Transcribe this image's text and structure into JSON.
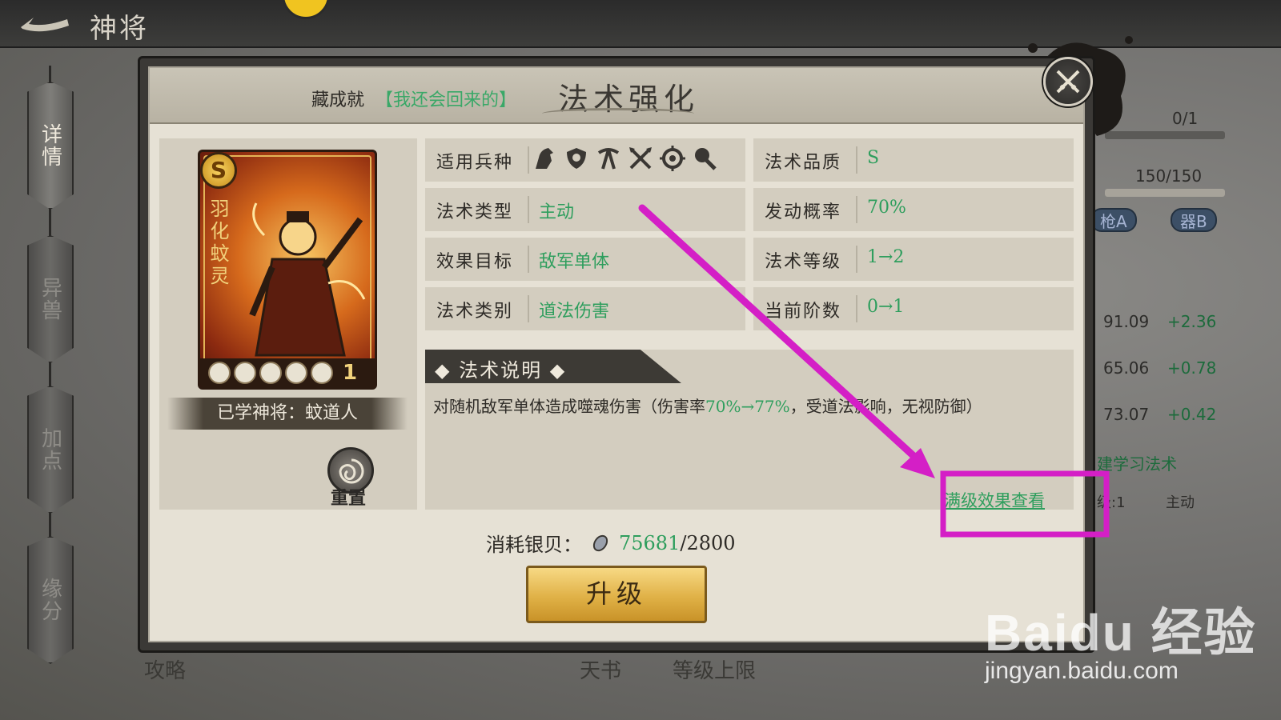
{
  "topbar": {
    "title": "神将"
  },
  "sidenav": [
    {
      "label": "详情",
      "active": true
    },
    {
      "label": "异兽",
      "active": false
    },
    {
      "label": "加点",
      "active": false
    },
    {
      "label": "缘分",
      "active": false
    }
  ],
  "background_panel": {
    "progress_a": "0/1",
    "progress_a_fraction": 0.0,
    "progress_b": "150/150",
    "progress_b_fraction": 1.0,
    "badge_a": "枪A",
    "badge_b": "器B",
    "stats": [
      {
        "value": "91.09",
        "delta": "+2.36"
      },
      {
        "value": "65.06",
        "delta": "+0.78"
      },
      {
        "value": "73.07",
        "delta": "+0.42"
      }
    ],
    "learn_link": "建学习法术",
    "level_text": "级:1",
    "type_text": "主动"
  },
  "dialog": {
    "achievement_label": "藏成就",
    "achievement_value": "【我还会回来的】",
    "title": "法术强化",
    "card": {
      "grade": "S",
      "name": "羽化蚊灵",
      "level": "1",
      "stars": 5,
      "learned_by": "已学神将：蚊道人",
      "reset_label": "重置"
    },
    "attributes_left": [
      {
        "label": "适用兵种",
        "value": ""
      },
      {
        "label": "法术类型",
        "value": "主动"
      },
      {
        "label": "效果目标",
        "value": "敌军单体"
      },
      {
        "label": "法术类别",
        "value": "道法伤害"
      }
    ],
    "attributes_right": [
      {
        "label": "法术品质",
        "value": "S"
      },
      {
        "label": "发动概率",
        "value": "70%"
      },
      {
        "label": "法术等级",
        "value": "1→2"
      },
      {
        "label": "当前阶数",
        "value": "0→1"
      }
    ],
    "unit_icons": [
      "horse-icon",
      "shield-icon",
      "crossbow-icon",
      "crossed-spears-icon",
      "target-icon",
      "hammer-icon"
    ],
    "description": {
      "heading": "◆ 法术说明 ◆",
      "text_before": "对随机敌军单体造成噬魂伤害（伤害率",
      "text_highlight": "70%→77%",
      "text_after": "，受道法影响，无视防御）"
    },
    "maxlevel_link": "满级效果查看",
    "cost": {
      "label": "消耗银贝：",
      "have": "75681",
      "need": "/2800"
    },
    "upgrade_label": "升级"
  },
  "bottom_ghost": [
    "攻略",
    "天书",
    "等级上限"
  ],
  "watermark": {
    "logo": "Baidu 经验",
    "url": "jingyan.baidu.com"
  },
  "colors": {
    "accent_green": "#2e9e5d",
    "annotation_magenta": "#d41fc6",
    "button_gold": "#e0b147"
  }
}
